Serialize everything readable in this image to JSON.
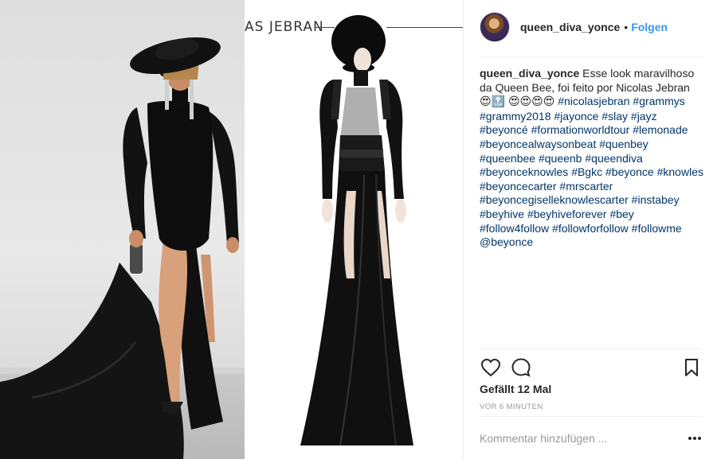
{
  "post_image": {
    "designer_text": "AS JEBRAN",
    "icons": [
      "hat-icon",
      "dress-figure-icon",
      "sketch-figure-icon"
    ]
  },
  "header": {
    "avatar_icon": "profile-avatar",
    "username": "queen_diva_yonce",
    "separator": "•",
    "follow_label": "Folgen",
    "follow_color": "#3897f0"
  },
  "caption": {
    "username": "queen_diva_yonce",
    "text": "Esse look maravilhoso da Queen Bee, foi feito por Nicolas Jebran",
    "emojis_before_top": "😍",
    "top_emoji": "🔝",
    "emojis_after_top": "😍😍😍😍",
    "hashtags": [
      "#nicolasjebran",
      "#grammys",
      "#grammy2018",
      "#jayonce",
      "#slay",
      "#jayz",
      "#beyoncé",
      "#formationworldtour",
      "#lemonade",
      "#beyoncealwaysonbeat",
      "#quenbey",
      "#queenbee",
      "#queenb",
      "#queendiva",
      "#beyonceknowles",
      "#Bgkc",
      "#beyonce",
      "#knowles",
      "#beyoncecarter",
      "#mrscarter",
      "#beyoncegiselleknowlescarter",
      "#instabey",
      "#beyhive",
      "#beyhiveforever",
      "#bey",
      "#follow4follow",
      "#followforfollow",
      "#followme"
    ],
    "mention": "@beyonce",
    "link_color": "#003569"
  },
  "actions": {
    "like_icon": "heart-icon",
    "comment_icon": "comment-bubble-icon",
    "save_icon": "bookmark-icon"
  },
  "likes_text": "Gefällt 12 Mal",
  "timestamp": "VOR 6 MINUTEN",
  "comment": {
    "placeholder": "Kommentar hinzufügen ...",
    "more_icon": "more-options-icon"
  }
}
